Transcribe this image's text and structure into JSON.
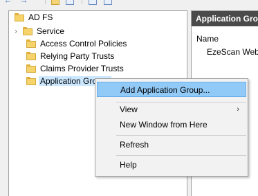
{
  "toolbar": {
    "icons": [
      "back-arrow-icon",
      "forward-arrow-icon",
      "folder-icon",
      "show-hide-tree-icon",
      "properties-icon",
      "help-icon"
    ]
  },
  "tree": {
    "root": "AD FS",
    "items": [
      {
        "label": "Service",
        "expandable": true
      },
      {
        "label": "Access Control Policies",
        "expandable": false
      },
      {
        "label": "Relying Party Trusts",
        "expandable": false
      },
      {
        "label": "Claims Provider Trusts",
        "expandable": false
      },
      {
        "label": "Application Groups",
        "expandable": false,
        "selected": true
      }
    ]
  },
  "right_panel": {
    "header": "Application Groups",
    "column": "Name",
    "rows": [
      "EzeScan WebApp"
    ]
  },
  "context_menu": {
    "items": [
      {
        "label": "Add Application Group...",
        "highlighted": true
      },
      {
        "label": "View",
        "submenu": true
      },
      {
        "label": "New Window from Here"
      },
      {
        "label": "Refresh"
      },
      {
        "label": "Help"
      }
    ]
  },
  "colors": {
    "selection": "#cce8ff",
    "menu_highlight": "#91c9f7",
    "panel_header": "#4a4a4a",
    "folder": "#f6d36b"
  }
}
